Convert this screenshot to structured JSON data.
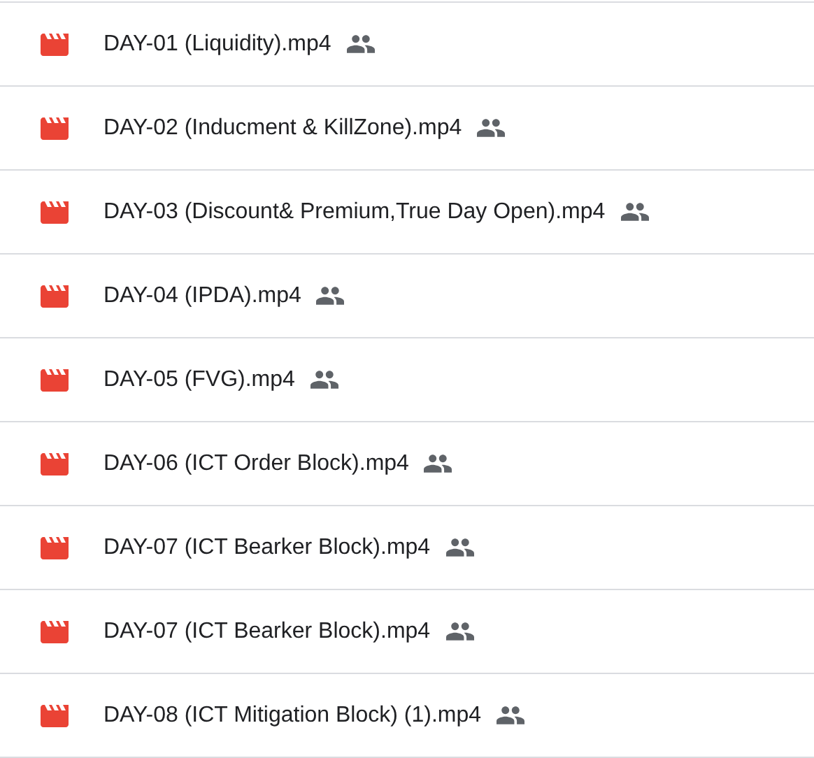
{
  "files": [
    {
      "name": "DAY-01 (Liquidity).mp4",
      "shared": true
    },
    {
      "name": "DAY-02 (Inducment & KillZone).mp4",
      "shared": true
    },
    {
      "name": "DAY-03 (Discount& Premium,True Day Open).mp4",
      "shared": true
    },
    {
      "name": "DAY-04 (IPDA).mp4",
      "shared": true
    },
    {
      "name": "DAY-05 (FVG).mp4",
      "shared": true
    },
    {
      "name": "DAY-06 (ICT Order Block).mp4",
      "shared": true
    },
    {
      "name": "DAY-07 (ICT Bearker Block).mp4",
      "shared": true
    },
    {
      "name": "DAY-07 (ICT Bearker Block).mp4",
      "shared": true
    },
    {
      "name": "DAY-08 (ICT Mitigation Block) (1).mp4",
      "shared": true
    }
  ]
}
